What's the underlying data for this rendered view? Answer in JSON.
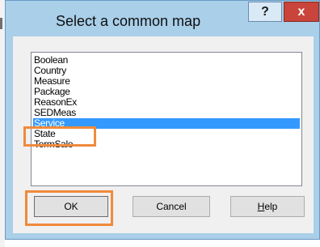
{
  "dialog": {
    "title": "Select a common map",
    "help_glyph": "?",
    "close_glyph": "x"
  },
  "list": {
    "items": [
      "Boolean",
      "Country",
      "Measure",
      "Package",
      "ReasonEx",
      "SEDMeas",
      "Service",
      "State",
      "TermSale"
    ],
    "selected": "Service"
  },
  "buttons": {
    "ok": "OK",
    "cancel": "Cancel",
    "help_mnemonic": "H",
    "help_rest": "elp"
  },
  "annotations": {
    "highlight_color": "#f08a3c"
  },
  "colors": {
    "title_bar": "#a9cfe9",
    "close_button": "#c9443a",
    "selection": "#3399ff"
  }
}
